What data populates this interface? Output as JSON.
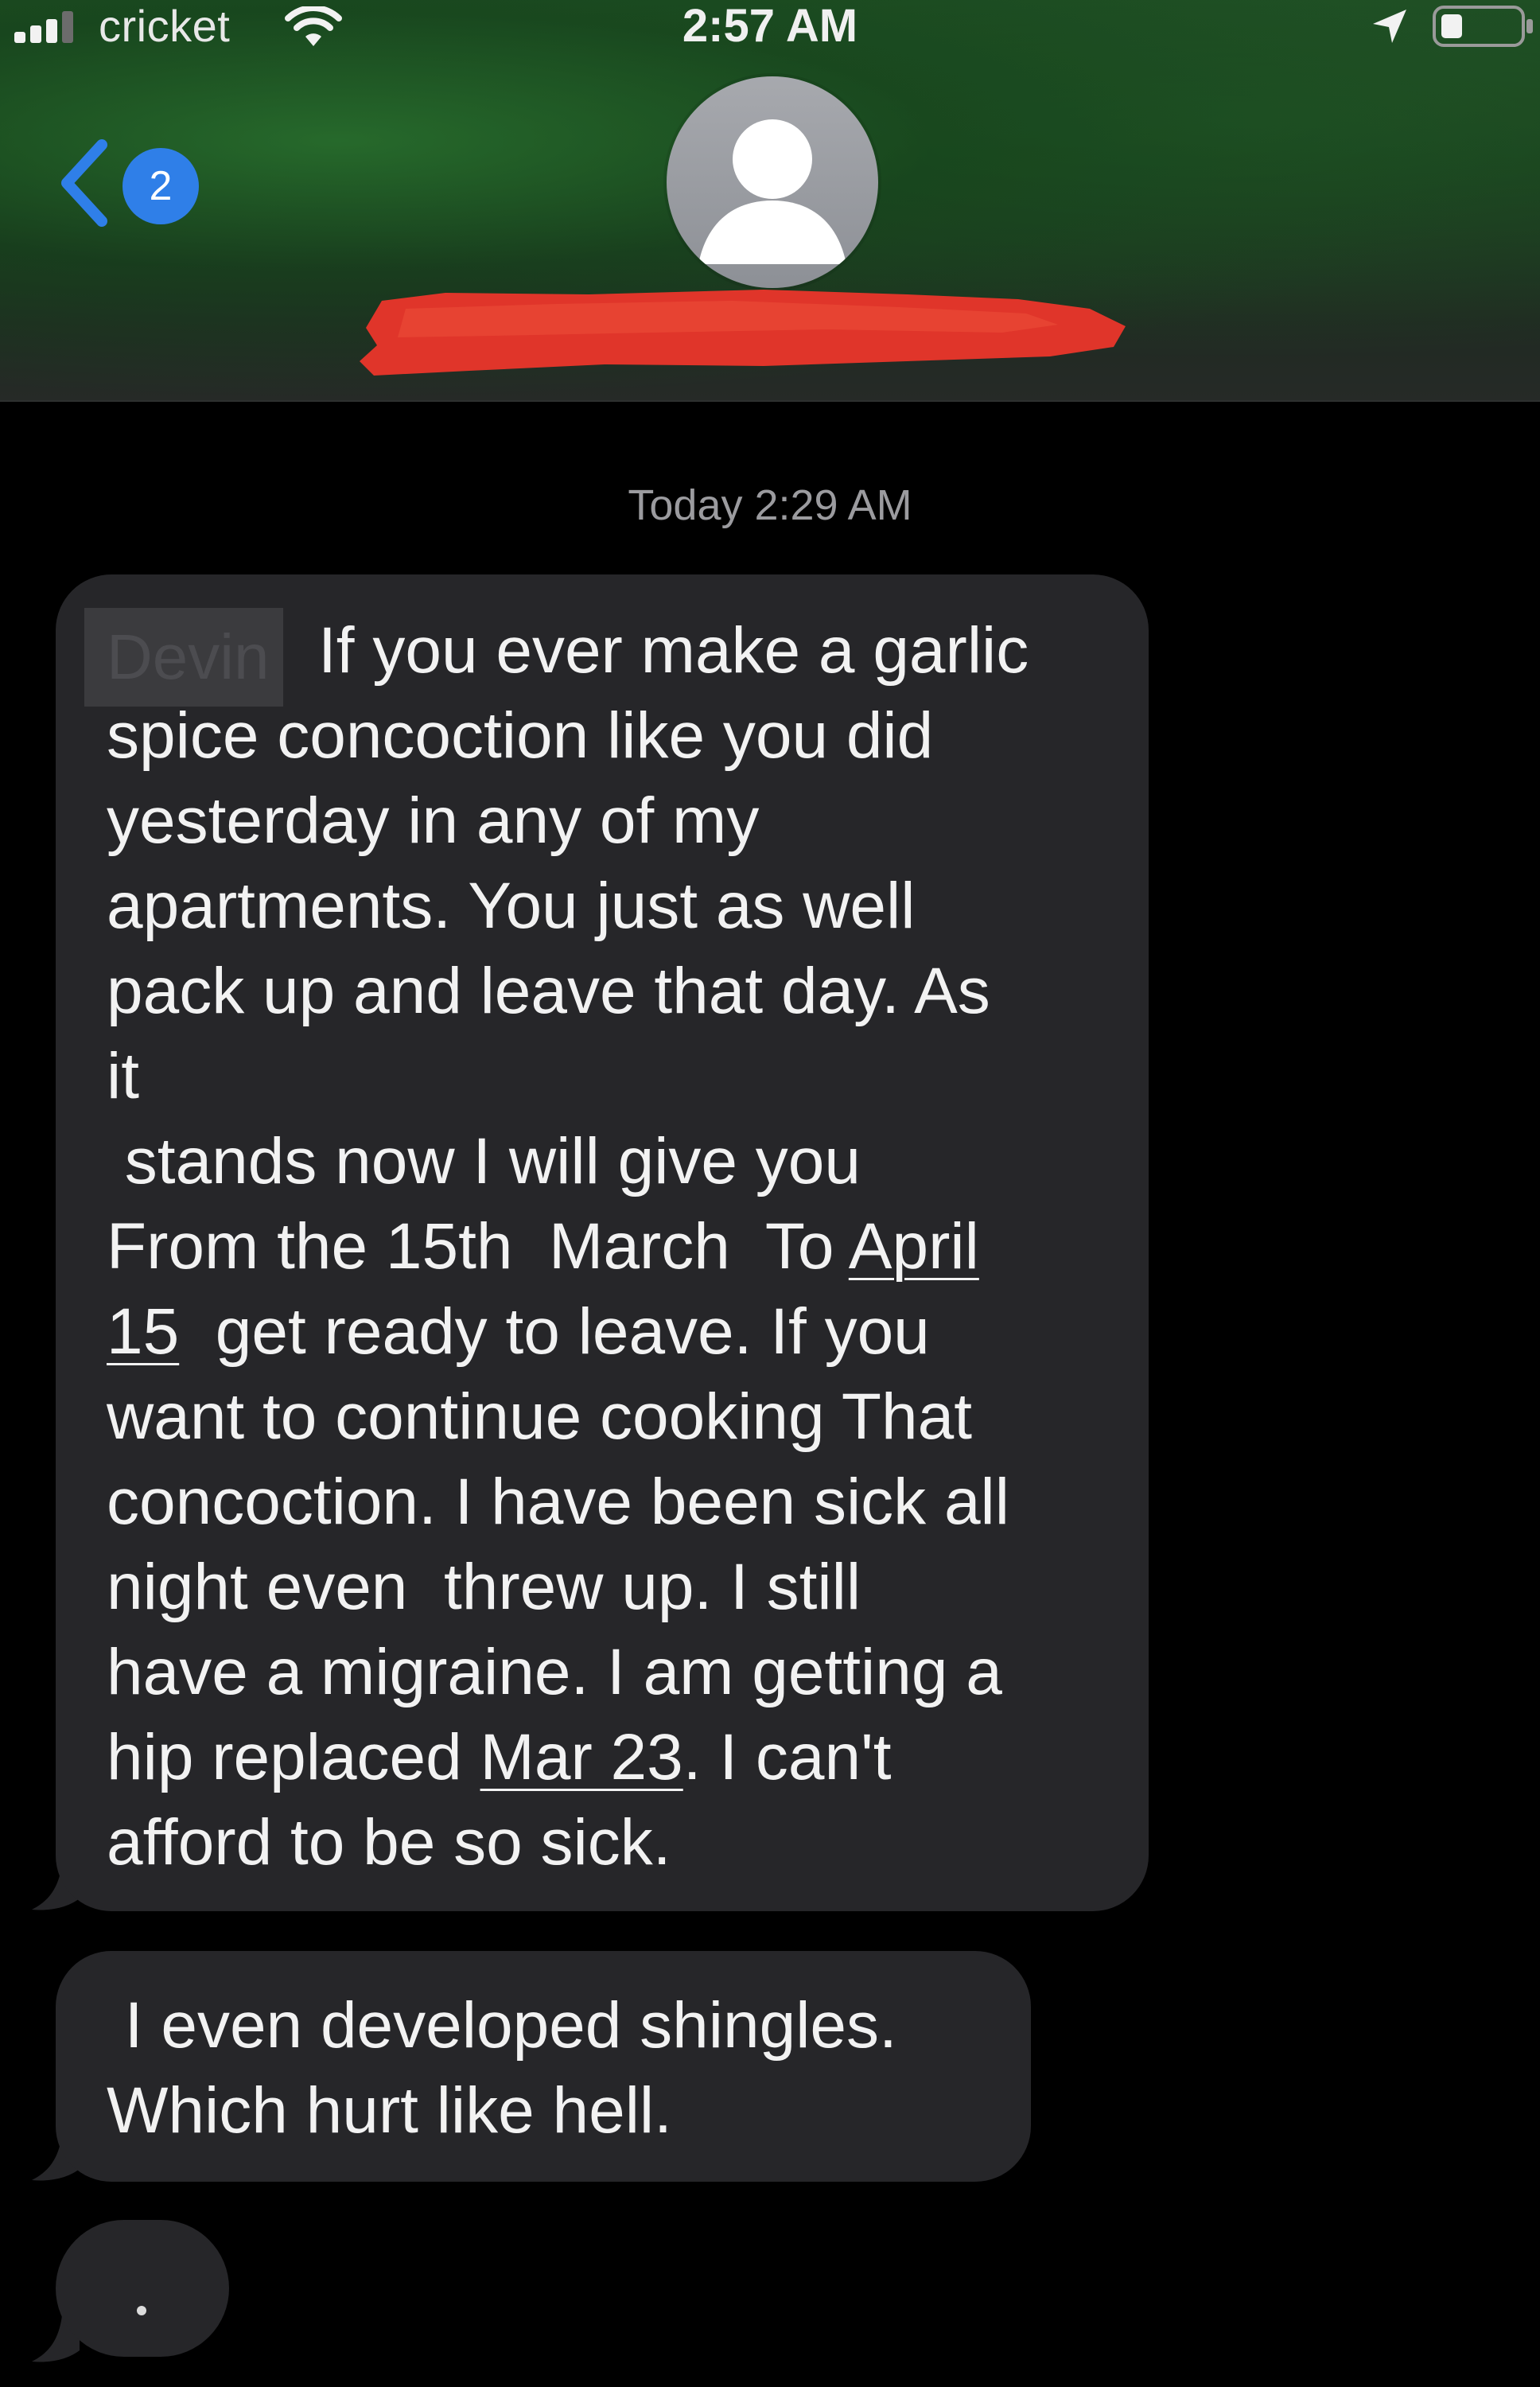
{
  "status_bar": {
    "carrier": "cricket",
    "time": "2:57 AM",
    "icons": [
      "signal-bars-icon",
      "wifi-icon",
      "location-arrow-icon",
      "battery-icon"
    ]
  },
  "nav": {
    "back_badge_count": "2",
    "icons": [
      "back-chevron-icon",
      "person-avatar-icon"
    ]
  },
  "conversation": {
    "timestamp": "Today 2:29 AM",
    "messages": [
      {
        "redacted_sender_prefix": "Devin",
        "lines": [
          "If you ever make a garlic",
          "spice concoction like you did",
          "yesterday in any of my",
          "apartments. You just as well",
          "pack up and leave that day. As",
          "it",
          " stands now I will give you",
          "From the 15th  March  To April",
          "15  get ready to leave. If you",
          "want to continue cooking That",
          "concoction. I have been sick all",
          "night even  threw up. I still",
          "have a migraine. I am getting a",
          "hip replaced Mar 23. I can't",
          "afford to be so sick."
        ]
      },
      {
        "lines": [
          " I even developed shingles.",
          "Which hurt like hell."
        ]
      }
    ],
    "typing_indicator": "."
  },
  "colors": {
    "header_green": "#1d4a22",
    "bubble_gray": "#262629",
    "badge_blue": "#2f7fe8",
    "redaction_red": "#e0352a",
    "background": "#000000"
  }
}
